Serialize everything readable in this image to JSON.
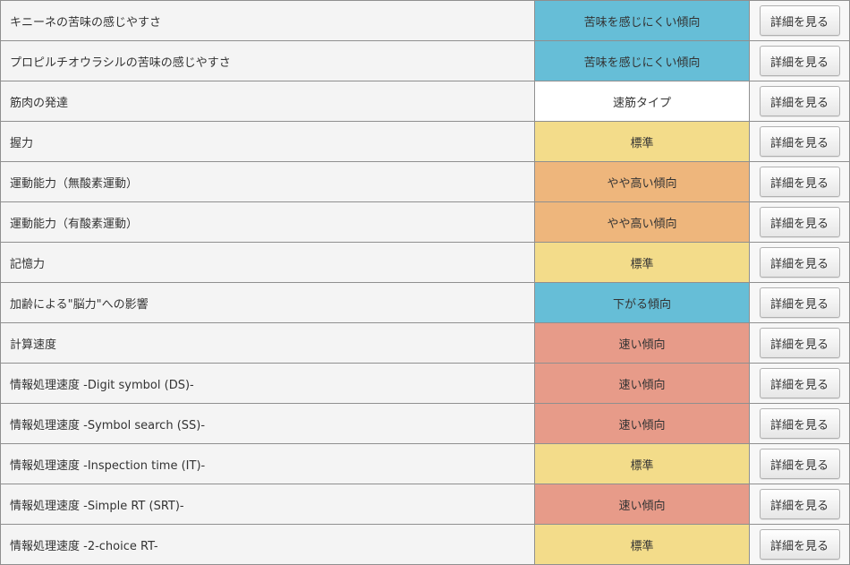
{
  "button_label": "詳細を見る",
  "colors": {
    "blue": "#66bed7",
    "white": "#ffffff",
    "yellow": "#f3dc8a",
    "orange": "#eeb67c",
    "red": "#e79b89"
  },
  "rows": [
    {
      "label": "キニーネの苦味の感じやすさ",
      "result": "苦味を感じにくい傾向",
      "color": "blue"
    },
    {
      "label": "プロピルチオウラシルの苦味の感じやすさ",
      "result": "苦味を感じにくい傾向",
      "color": "blue"
    },
    {
      "label": "筋肉の発達",
      "result": "速筋タイプ",
      "color": "white"
    },
    {
      "label": "握力",
      "result": "標準",
      "color": "yellow"
    },
    {
      "label": "運動能力（無酸素運動）",
      "result": "やや高い傾向",
      "color": "orange"
    },
    {
      "label": "運動能力（有酸素運動）",
      "result": "やや高い傾向",
      "color": "orange"
    },
    {
      "label": "記憶力",
      "result": "標準",
      "color": "yellow"
    },
    {
      "label": "加齢による\"脳力\"への影響",
      "result": "下がる傾向",
      "color": "blue"
    },
    {
      "label": "計算速度",
      "result": "速い傾向",
      "color": "red"
    },
    {
      "label": "情報処理速度 -Digit symbol (DS)-",
      "result": "速い傾向",
      "color": "red"
    },
    {
      "label": "情報処理速度 -Symbol search (SS)-",
      "result": "速い傾向",
      "color": "red"
    },
    {
      "label": "情報処理速度 -Inspection time (IT)-",
      "result": "標準",
      "color": "yellow"
    },
    {
      "label": "情報処理速度 -Simple RT (SRT)-",
      "result": "速い傾向",
      "color": "red"
    },
    {
      "label": "情報処理速度 -2-choice RT-",
      "result": "標準",
      "color": "yellow"
    }
  ]
}
